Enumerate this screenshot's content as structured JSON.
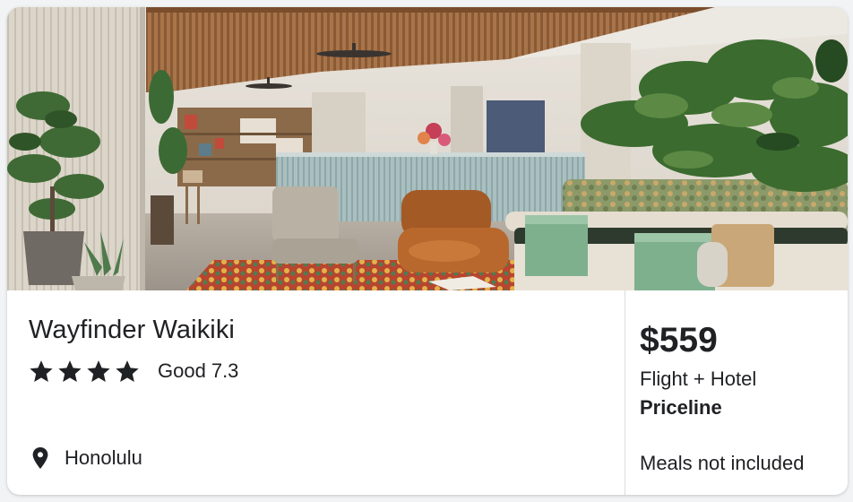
{
  "hotel": {
    "name": "Wayfinder Waikiki",
    "stars": 4,
    "rating_word": "Good",
    "rating_score": "7.3",
    "location": "Honolulu",
    "icons": {
      "star": "star-icon",
      "location": "location-pin-icon"
    }
  },
  "offer": {
    "price": "$559",
    "package": "Flight + Hotel",
    "provider": "Priceline",
    "meals": "Meals not included"
  },
  "colors": {
    "text": "#202124",
    "divider": "#dadce0",
    "card_bg": "#ffffff"
  }
}
